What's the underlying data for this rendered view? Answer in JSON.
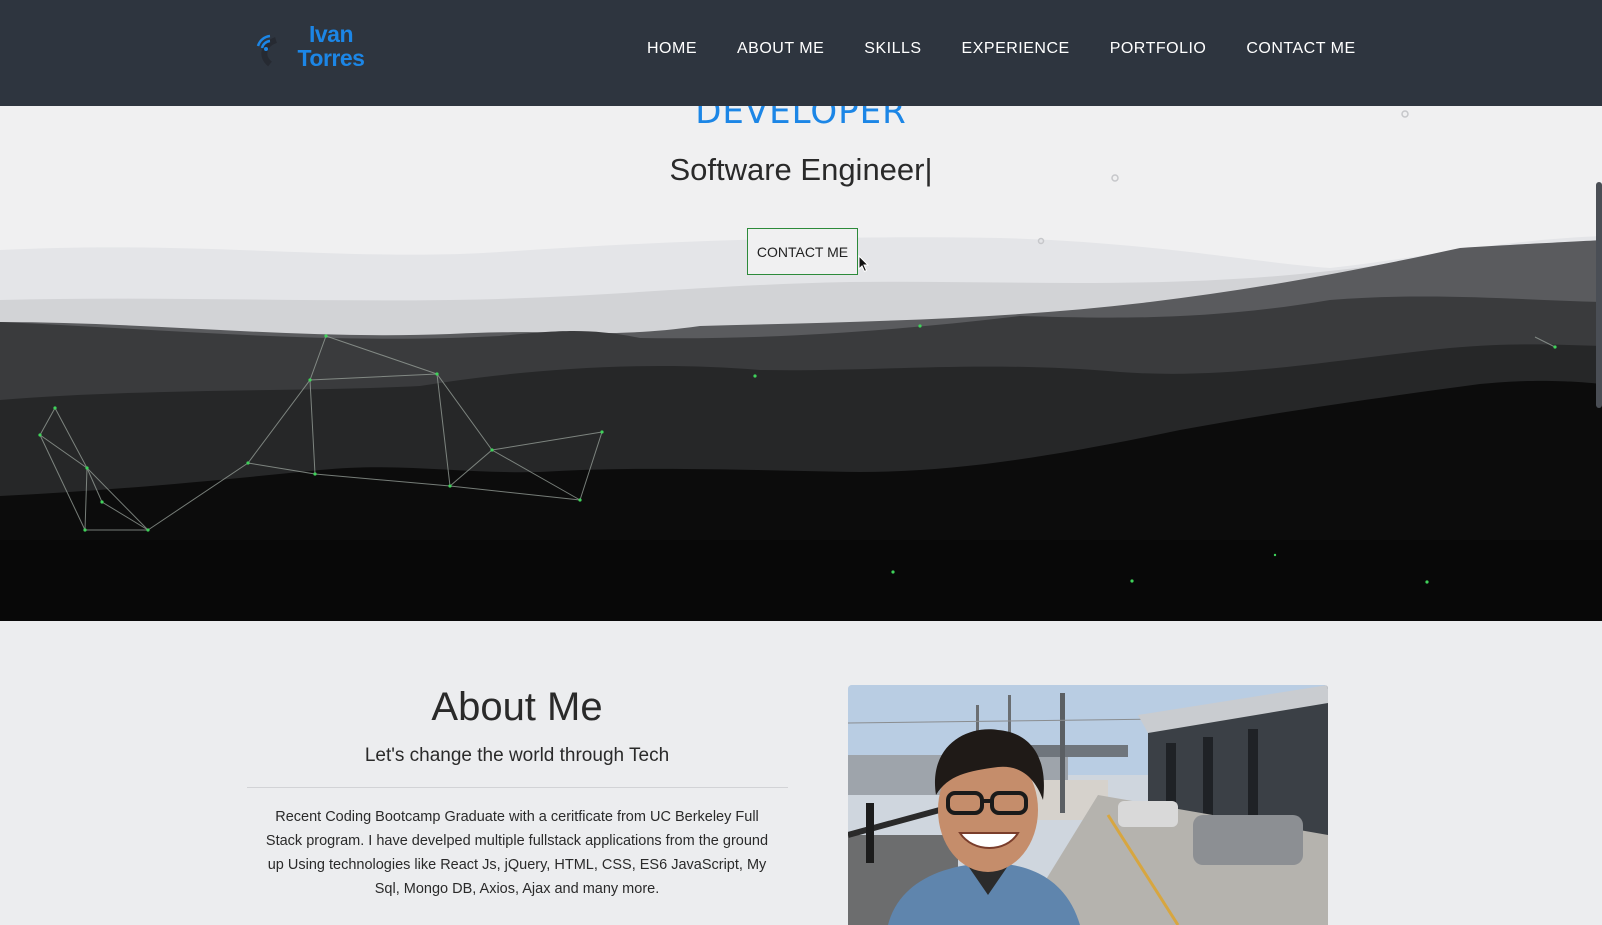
{
  "nav": {
    "logo_line1": "Ivan",
    "logo_line2": "Torres",
    "links": [
      "HOME",
      "ABOUT ME",
      "SKILLS",
      "EXPERIENCE",
      "PORTFOLIO",
      "CONTACT ME"
    ]
  },
  "hero": {
    "role": "DEVELOPER",
    "subtitle": "Software Engineer|",
    "button_label": "CONTACT ME"
  },
  "about": {
    "title": "About Me",
    "subtitle": "Let's change the world through Tech",
    "body": "Recent Coding Bootcamp Graduate with a ceritficate from UC Berkeley Full Stack program. I have develped multiple fullstack applications from the ground up Using technologies like React Js, jQuery, HTML, CSS, ES6 JavaScript, My Sql, Mongo DB, Axios, Ajax and many more."
  },
  "colors": {
    "accent": "#1c86e6",
    "nav_bg": "#2e353f",
    "button_border": "#2c8a3a",
    "particle": "#3fd25a"
  },
  "icons": {
    "logo": "wifi-signal-icon",
    "cursor": "mouse-pointer-icon"
  }
}
